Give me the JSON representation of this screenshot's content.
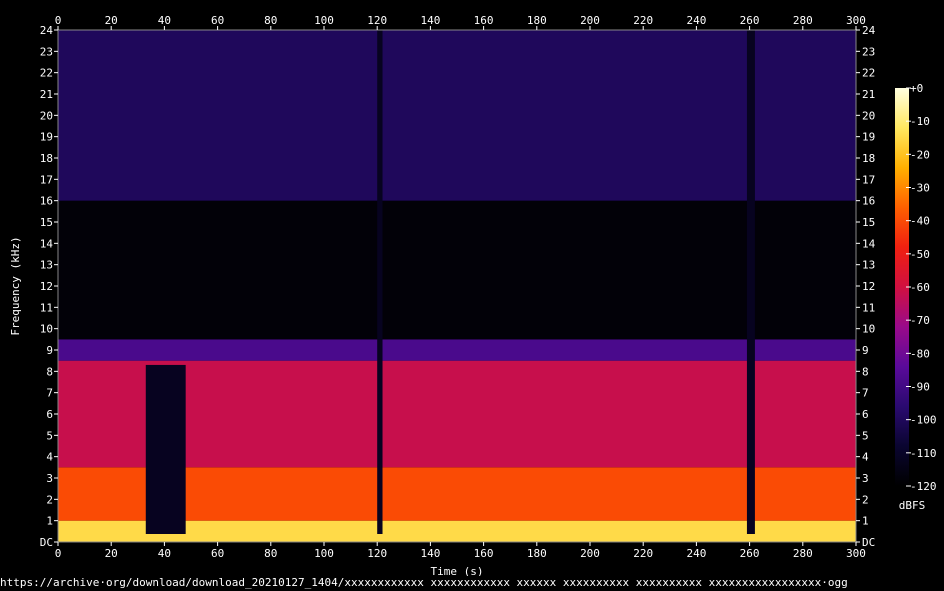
{
  "footer": {
    "url": "https://archive·org/download/download_20210127_1404/xxxxxxxxxxxx xxxxxxxxxxxx xxxxxx xxxxxxxxxx xxxxxxxxxx xxxxxxxxxxxxxxxxx·ogg"
  },
  "chart_data": {
    "type": "heatmap",
    "title": "",
    "xlabel": "Time (s)",
    "ylabel": "Frequency (kHz)",
    "xlim": [
      0,
      300
    ],
    "ylim": [
      0,
      24
    ],
    "x_ticks": [
      0,
      20,
      40,
      60,
      80,
      100,
      120,
      140,
      160,
      180,
      200,
      220,
      240,
      260,
      280,
      300
    ],
    "y_ticks": [
      "DC",
      "1",
      "2",
      "3",
      "4",
      "5",
      "6",
      "7",
      "8",
      "9",
      "10",
      "11",
      "12",
      "13",
      "14",
      "15",
      "16",
      "17",
      "18",
      "19",
      "20",
      "21",
      "22",
      "23",
      "24"
    ],
    "y_tick_values": [
      0,
      1,
      2,
      3,
      4,
      5,
      6,
      7,
      8,
      9,
      10,
      11,
      12,
      13,
      14,
      15,
      16,
      17,
      18,
      19,
      20,
      21,
      22,
      23,
      24
    ],
    "grid": false,
    "colorbar": {
      "label": "dBFS",
      "ticks": [
        "+0",
        "-10",
        "-20",
        "-30",
        "-40",
        "-50",
        "-60",
        "-70",
        "-80",
        "-90",
        "-100",
        "-110",
        "-120"
      ],
      "tick_values": [
        0,
        -10,
        -20,
        -30,
        -40,
        -50,
        -60,
        -70,
        -80,
        -90,
        -100,
        -110,
        -120
      ],
      "range": [
        -120,
        0
      ],
      "colors": [
        "#000000",
        "#0a0530",
        "#2a0a70",
        "#5a0a9a",
        "#9a0a8a",
        "#d01040",
        "#f02010",
        "#ff6000",
        "#ffb000",
        "#ffe860",
        "#ffffe0"
      ]
    },
    "bands_db": [
      {
        "from_khz": 0,
        "to_khz": 1,
        "level_db": -15
      },
      {
        "from_khz": 1,
        "to_khz": 3.5,
        "level_db": -40
      },
      {
        "from_khz": 3.5,
        "to_khz": 8.5,
        "level_db": -62
      },
      {
        "from_khz": 8.5,
        "to_khz": 9.5,
        "level_db": -88
      },
      {
        "from_khz": 9.5,
        "to_khz": 16,
        "level_db": -118
      },
      {
        "from_khz": 16,
        "to_khz": 24,
        "level_db": -100
      }
    ],
    "quiet_segments_s": [
      {
        "from": 33,
        "to": 48,
        "max_khz": 8.3
      },
      {
        "from": 120,
        "to": 122,
        "max_khz": 24
      },
      {
        "from": 259,
        "to": 262,
        "max_khz": 24
      }
    ]
  }
}
